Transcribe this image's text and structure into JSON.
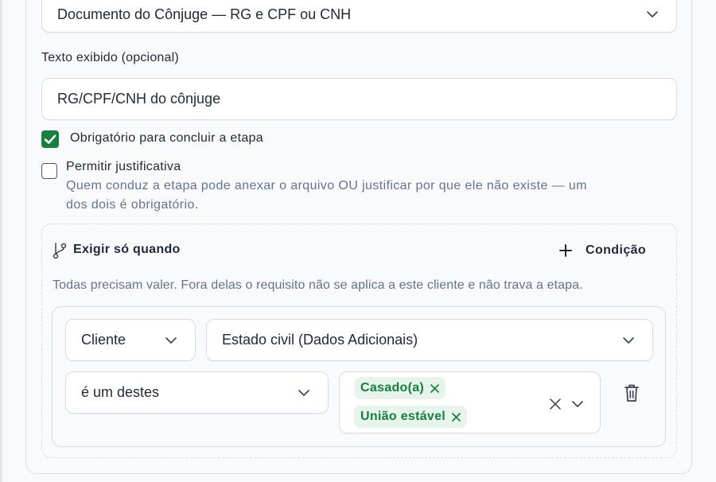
{
  "document_select": {
    "value": "Documento do Cônjuge — RG e CPF ou CNH"
  },
  "display_text": {
    "label": "Texto exibido (opcional)",
    "value": "RG/CPF/CNH do cônjuge"
  },
  "required_checkbox": {
    "checked": true,
    "label": "Obrigatório para concluir a etapa"
  },
  "justification_checkbox": {
    "checked": false,
    "label": "Permitir justificativa",
    "hint_line1": "Quem conduz a etapa pode anexar o arquivo OU justificar por que ele não existe — um",
    "hint_line2": "dos dois é obrigatório."
  },
  "conditions": {
    "title": "Exigir só quando",
    "add_label": "Condição",
    "description": "Todas precisam valer. Fora delas o requisito não se aplica a este cliente e não trava a etapa.",
    "rule": {
      "entity": "Cliente",
      "field": "Estado civil (Dados Adicionais)",
      "operator": "é um destes",
      "values": [
        "Casado(a)",
        "União estável"
      ]
    }
  },
  "colors": {
    "accent": "#16803c",
    "tag_bg": "#e6f4ec",
    "tag_text": "#15803d"
  }
}
